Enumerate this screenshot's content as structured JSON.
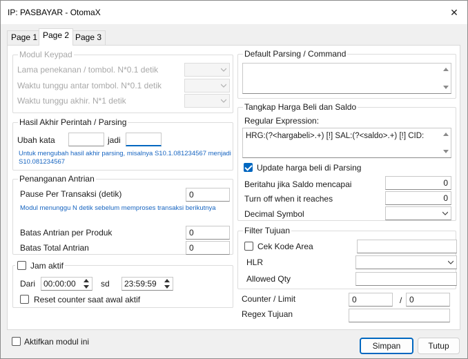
{
  "window": {
    "title": "IP: PASBAYAR - OtomaX",
    "close_glyph": "✕"
  },
  "tabs": [
    {
      "label": "Page 1",
      "active": false
    },
    {
      "label": "Page 2",
      "active": true
    },
    {
      "label": "Page 3",
      "active": false
    }
  ],
  "modul_keypad": {
    "title": "Modul Keypad",
    "rows": [
      {
        "label": "Lama penekanan / tombol. N*0.1 detik",
        "value": ""
      },
      {
        "label": "Waktu tunggu antar tombol. N*0.1 detik",
        "value": ""
      },
      {
        "label": "Waktu tunggu akhir. N*1 detik",
        "value": ""
      }
    ]
  },
  "hasil_akhir": {
    "title": "Hasil Akhir Perintah / Parsing",
    "ubah_label": "Ubah kata",
    "ubah_value": "",
    "jadi_label": "jadi",
    "jadi_value": "",
    "hint": "Untuk mengubah hasil akhir parsing, misalnya S10.1.081234567 menjadi S10.081234567"
  },
  "penanganan": {
    "title": "Penanganan Antrian",
    "pause_label": "Pause Per Transaksi (detik)",
    "pause_value": "0",
    "hint": "Modul menunggu N detik sebelum memproses transaksi berikutnya",
    "batas_produk_label": "Batas Antrian per Produk",
    "batas_produk_value": "0",
    "batas_total_label": "Batas Total Antrian",
    "batas_total_value": "0"
  },
  "jam_aktif": {
    "label": "Jam aktif",
    "checked": false,
    "dari_label": "Dari",
    "dari_value": "00:00:00",
    "sd_label": "sd",
    "sd_value": "23:59:59",
    "reset_label": "Reset counter saat awal aktif",
    "reset_checked": false
  },
  "default_parsing": {
    "title": "Default Parsing / Command",
    "value": ""
  },
  "tangkap": {
    "title": "Tangkap Harga Beli dan Saldo",
    "regex_label": "Regular Expression:",
    "regex_value": "HRG:(?<hargabeli>.+) [!] SAL:(?<saldo>.+) [!] CID:",
    "update_label": "Update harga beli di Parsing",
    "update_checked": true,
    "beritahu_label": "Beritahu jika Saldo mencapai",
    "beritahu_value": "0",
    "turnoff_label": "Turn off when it reaches",
    "turnoff_value": "0",
    "decimal_label": "Decimal Symbol",
    "decimal_value": ""
  },
  "filter_tujuan": {
    "title": "Filter Tujuan",
    "cek_label": "Cek Kode Area",
    "cek_checked": false,
    "cek_value": "",
    "hlr_label": "HLR",
    "hlr_value": "",
    "allowed_label": "Allowed Qty",
    "allowed_value": ""
  },
  "counter": {
    "label": "Counter / Limit",
    "value1": "0",
    "separator": "/",
    "value2": "0"
  },
  "regex_tujuan": {
    "label": "Regex Tujuan",
    "value": ""
  },
  "footer": {
    "aktifkan_label": "Aktifkan modul ini",
    "aktifkan_checked": false,
    "simpan_label": "Simpan",
    "tutup_label": "Tutup"
  },
  "colors": {
    "accent": "#0067c0",
    "hint": "#1664c0",
    "disabled_text": "#a8a8a8"
  }
}
